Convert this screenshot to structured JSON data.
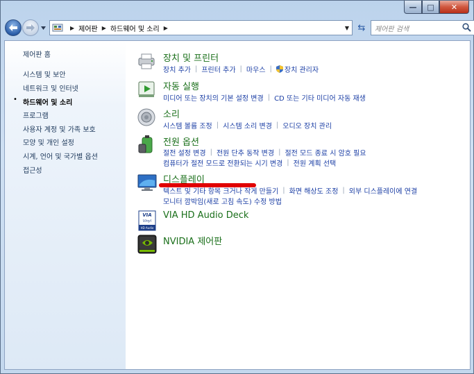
{
  "window": {
    "minimize_glyph": "—",
    "maximize_glyph": "□",
    "close_glyph": "✕"
  },
  "navbar": {
    "breadcrumbs": [
      "제어판",
      "하드웨어 및 소리"
    ],
    "search_placeholder": "제어판 검색"
  },
  "sidebar": {
    "items": [
      {
        "label": "제어판 홈"
      },
      {
        "label": "시스템 및 보안"
      },
      {
        "label": "네트워크 및 인터넷"
      },
      {
        "label": "하드웨어 및 소리"
      },
      {
        "label": "프로그램"
      },
      {
        "label": "사용자 계정 및 가족 보호"
      },
      {
        "label": "모양 및 개인 설정"
      },
      {
        "label": "시계, 언어 및 국가별 옵션"
      },
      {
        "label": "접근성"
      }
    ],
    "bullet": "•"
  },
  "categories": {
    "devices": {
      "title": "장치 및 프린터",
      "links": [
        "장치 추가",
        "프린터 추가",
        "마우스",
        "장치 관리자"
      ]
    },
    "autoplay": {
      "title": "자동 실행",
      "links": [
        "미디어 또는 장치의 기본 설정 변경",
        "CD 또는 기타 미디어 자동 재생"
      ]
    },
    "sound": {
      "title": "소리",
      "links": [
        "시스템 볼륨 조정",
        "시스템 소리 변경",
        "오디오 장치 관리"
      ]
    },
    "power": {
      "title": "전원 옵션",
      "links_row1": [
        "절전 설정 변경",
        "전원 단추 동작 변경",
        "절전 모드 종료 시 암호 필요"
      ],
      "links_row2": [
        "컴퓨터가 절전 모드로 전환되는 시기 변경",
        "전원 계획 선택"
      ]
    },
    "display": {
      "title": "디스플레이",
      "links_row1": [
        "텍스트 및 기타 항목 크거나 작게 만들기",
        "화면 해상도 조정",
        "외부 디스플레이에 연결"
      ],
      "links_row2": [
        "모니터 깜박임(새로 고침 속도) 수정 방법"
      ]
    },
    "via": {
      "title": "VIA HD Audio Deck",
      "icon_text": [
        "VIA",
        "Vinyl",
        "HD Audio"
      ]
    },
    "nvidia": {
      "title": "NVIDIA 제어판"
    }
  }
}
